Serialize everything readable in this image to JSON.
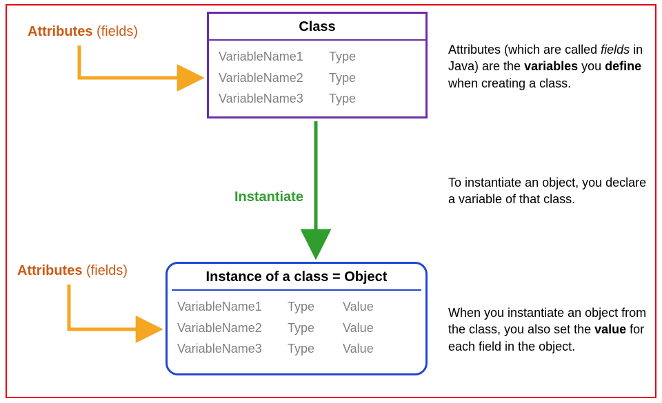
{
  "labels": {
    "attributes_html": "Attributes <span class=\"attr-paren\">(fields)</span>",
    "instantiate": "Instantiate"
  },
  "class_box": {
    "title": "Class",
    "rows": [
      {
        "name": "VariableName1",
        "type": "Type"
      },
      {
        "name": "VariableName2",
        "type": "Type"
      },
      {
        "name": "VariableName3",
        "type": "Type"
      }
    ]
  },
  "instance_box": {
    "title": "Instance of a class = Object",
    "rows": [
      {
        "name": "VariableName1",
        "type": "Type",
        "value": "Value"
      },
      {
        "name": "VariableName2",
        "type": "Type",
        "value": "Value"
      },
      {
        "name": "VariableName3",
        "type": "Type",
        "value": "Value"
      }
    ]
  },
  "paragraphs": {
    "p1_html": "Attributes (which are called <span class=\"italic\">fields</span> in Java) are the <span class=\"bold\">variables</span> you <span class=\"bold\">define</span> when creating a class.",
    "p2_html": "To instantiate an object, you declare a variable of that class.",
    "p3_html": "When you instantiate an object from the class, you also set the <span class=\"bold\">value</span> for each field in the object."
  },
  "colors": {
    "orange": "#f5a623",
    "green": "#2f9e2f",
    "purple": "#6a2da6",
    "blue": "#2146d6",
    "red": "#e30613"
  }
}
